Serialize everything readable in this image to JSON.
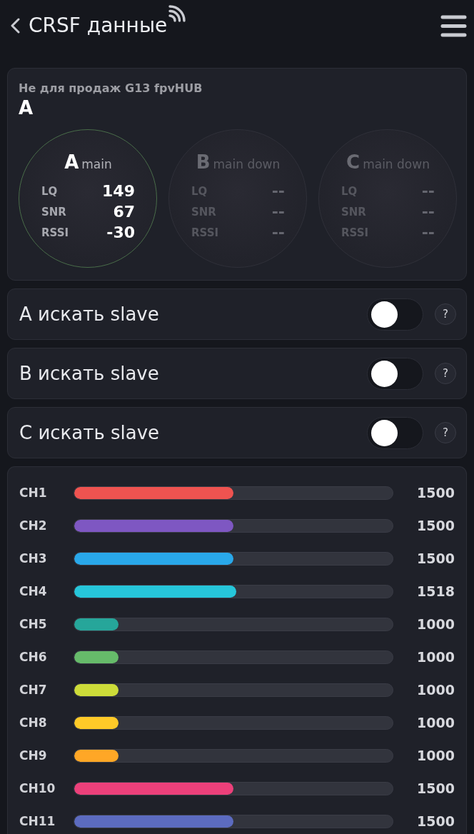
{
  "header": {
    "title": "CRSF данные"
  },
  "receiver": {
    "name": "Не для продаж G13 fpvHUB",
    "active": "A",
    "links": [
      {
        "letter": "A",
        "role": "main",
        "selected": true,
        "stats": [
          {
            "label": "LQ",
            "value": "149"
          },
          {
            "label": "SNR",
            "value": "67"
          },
          {
            "label": "RSSI",
            "value": "-30"
          }
        ]
      },
      {
        "letter": "B",
        "role": "main down",
        "selected": false,
        "stats": [
          {
            "label": "LQ",
            "value": "--"
          },
          {
            "label": "SNR",
            "value": "--"
          },
          {
            "label": "RSSI",
            "value": "--"
          }
        ]
      },
      {
        "letter": "C",
        "role": "main down",
        "selected": false,
        "stats": [
          {
            "label": "LQ",
            "value": "--"
          },
          {
            "label": "SNR",
            "value": "--"
          },
          {
            "label": "RSSI",
            "value": "--"
          }
        ]
      }
    ]
  },
  "toggles": [
    {
      "label": "A искать slave",
      "on": false,
      "help": "?"
    },
    {
      "label": "B искать slave",
      "on": false,
      "help": "?"
    },
    {
      "label": "C искать slave",
      "on": false,
      "help": "?"
    }
  ],
  "channels": [
    {
      "name": "CH1",
      "level": 0.5,
      "value": "1500",
      "color": "#ef5350"
    },
    {
      "name": "CH2",
      "level": 0.5,
      "value": "1500",
      "color": "#7e57c2"
    },
    {
      "name": "CH3",
      "level": 0.5,
      "value": "1500",
      "color": "#29a8ea"
    },
    {
      "name": "CH4",
      "level": 0.51,
      "value": "1518",
      "color": "#26c6da"
    },
    {
      "name": "CH5",
      "level": 0.14,
      "value": "1000",
      "color": "#26a69a"
    },
    {
      "name": "CH6",
      "level": 0.14,
      "value": "1000",
      "color": "#66bb6a"
    },
    {
      "name": "CH7",
      "level": 0.14,
      "value": "1000",
      "color": "#cddc39"
    },
    {
      "name": "CH8",
      "level": 0.14,
      "value": "1000",
      "color": "#ffca28"
    },
    {
      "name": "CH9",
      "level": 0.14,
      "value": "1000",
      "color": "#ffa726"
    },
    {
      "name": "CH10",
      "level": 0.5,
      "value": "1500",
      "color": "#ec407a"
    },
    {
      "name": "CH11",
      "level": 0.5,
      "value": "1500",
      "color": "#5c6bc0"
    }
  ]
}
